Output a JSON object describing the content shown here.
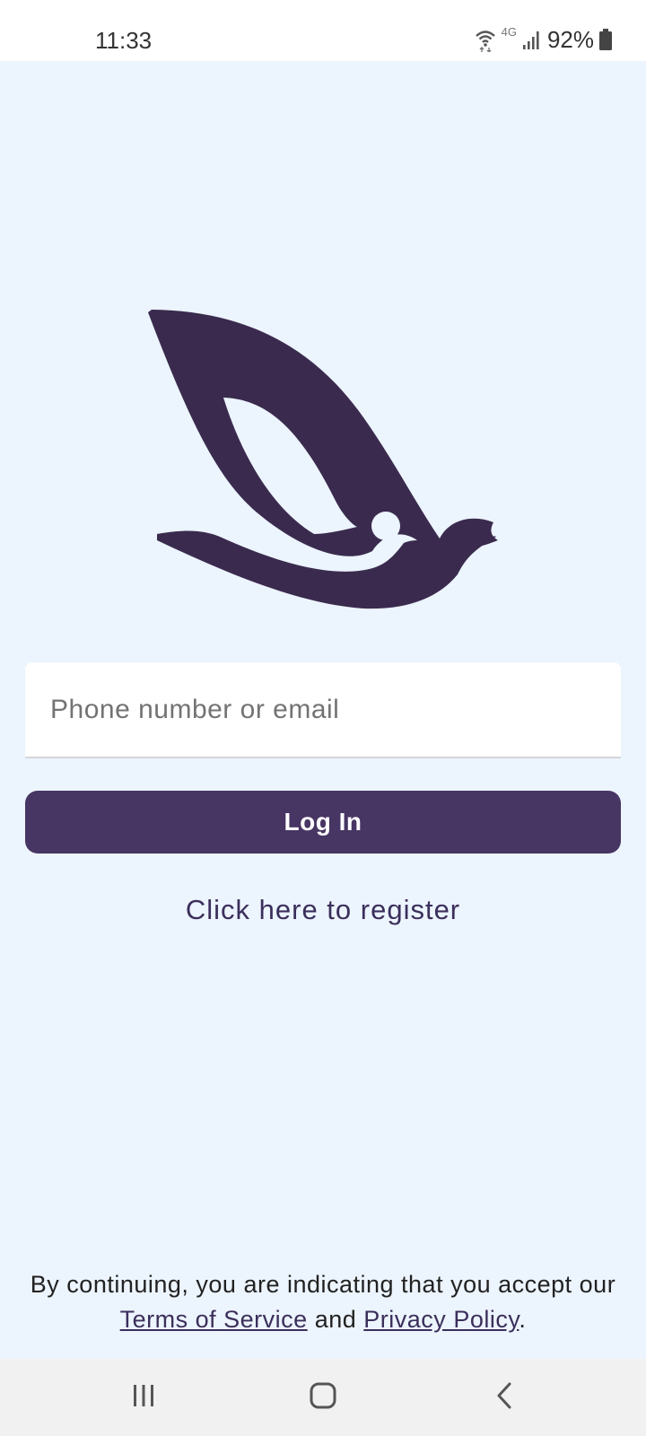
{
  "status_bar": {
    "time": "11:33",
    "network": "4G",
    "battery": "92%"
  },
  "brand": {
    "logo_icon": "bird-logo-icon",
    "color": "#3a2b4e"
  },
  "login_form": {
    "input_placeholder": "Phone number or email",
    "input_value": "",
    "login_label": "Log In",
    "register_label": "Click here to register"
  },
  "legal": {
    "prefix": "By continuing, you are indicating that you accept our",
    "terms_label": "Terms of Service",
    "connector": "and",
    "privacy_label": "Privacy Policy",
    "suffix": "."
  },
  "colors": {
    "background": "#ecf4fd",
    "primary_button": "#473563",
    "link": "#3b2f5b"
  },
  "nav_bar": {
    "recents_icon": "recents-icon",
    "home_icon": "home-icon",
    "back_icon": "back-icon"
  }
}
